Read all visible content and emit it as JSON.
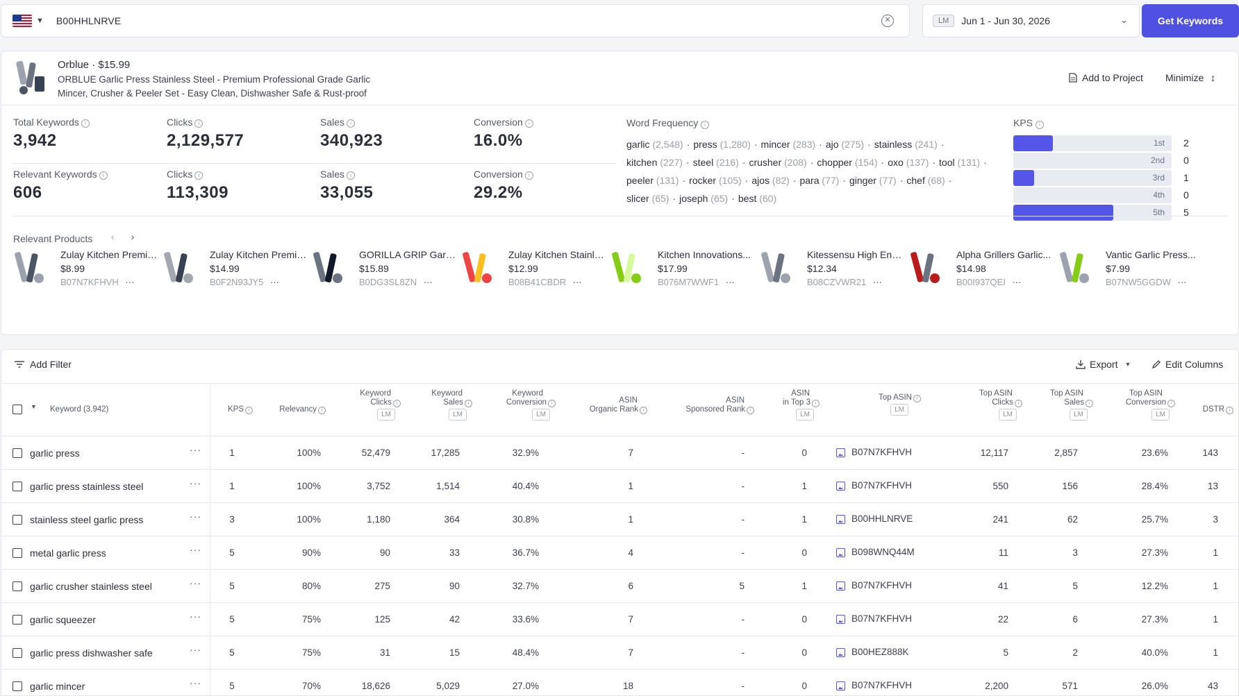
{
  "search": {
    "value": "B00HHLNRVE"
  },
  "date": {
    "tag": "LM",
    "range": "Jun 1 - Jun 30, 2026"
  },
  "buttons": {
    "get_keywords": "Get Keywords",
    "add_to_project": "Add to Project",
    "minimize": "Minimize",
    "add_filter": "Add Filter",
    "export": "Export",
    "edit_columns": "Edit Columns"
  },
  "product": {
    "brand": "Orblue",
    "price": "$15.99",
    "title": "ORBLUE Garlic Press Stainless Steel - Premium Professional Grade Garlic Mincer, Crusher & Peeler Set - Easy Clean, Dishwasher Safe & Rust-proof"
  },
  "stats": {
    "total_keywords": {
      "label": "Total Keywords",
      "value": "3,942"
    },
    "clicks": {
      "label": "Clicks",
      "value": "2,129,577"
    },
    "sales": {
      "label": "Sales",
      "value": "340,923"
    },
    "conversion": {
      "label": "Conversion",
      "value": "16.0%"
    },
    "relevant_keywords": {
      "label": "Relevant Keywords",
      "value": "606"
    },
    "rel_clicks": {
      "label": "Clicks",
      "value": "113,309"
    },
    "rel_sales": {
      "label": "Sales",
      "value": "33,055"
    },
    "rel_conversion": {
      "label": "Conversion",
      "value": "29.2%"
    }
  },
  "word_frequency": {
    "label": "Word Frequency",
    "words": [
      {
        "w": "garlic",
        "n": "(2,548)"
      },
      {
        "w": "press",
        "n": "(1,280)"
      },
      {
        "w": "mincer",
        "n": "(283)"
      },
      {
        "w": "ajo",
        "n": "(275)"
      },
      {
        "w": "stainless",
        "n": "(241)"
      },
      {
        "w": "kitchen",
        "n": "(227)"
      },
      {
        "w": "steel",
        "n": "(216)"
      },
      {
        "w": "crusher",
        "n": "(208)"
      },
      {
        "w": "chopper",
        "n": "(154)"
      },
      {
        "w": "oxo",
        "n": "(137)"
      },
      {
        "w": "tool",
        "n": "(131)"
      },
      {
        "w": "peeler",
        "n": "(131)"
      },
      {
        "w": "rocker",
        "n": "(105)"
      },
      {
        "w": "ajos",
        "n": "(82)"
      },
      {
        "w": "para",
        "n": "(77)"
      },
      {
        "w": "ginger",
        "n": "(77)"
      },
      {
        "w": "chef",
        "n": "(68)"
      },
      {
        "w": "slicer",
        "n": "(65)"
      },
      {
        "w": "joseph",
        "n": "(65)"
      },
      {
        "w": "best",
        "n": "(60)"
      }
    ]
  },
  "kps": {
    "label": "KPS",
    "rows": [
      {
        "name": "1st",
        "count": "2",
        "fill": 0.25
      },
      {
        "name": "2nd",
        "count": "0",
        "fill": 0
      },
      {
        "name": "3rd",
        "count": "1",
        "fill": 0.13
      },
      {
        "name": "4th",
        "count": "0",
        "fill": 0
      },
      {
        "name": "5th",
        "count": "5",
        "fill": 0.63
      }
    ]
  },
  "relevant_products": {
    "label": "Relevant Products",
    "items": [
      {
        "name": "Zulay Kitchen Premium...",
        "price": "$8.99",
        "asin": "B07N7KFHVH"
      },
      {
        "name": "Zulay Kitchen Premium...",
        "price": "$14.99",
        "asin": "B0F2N93JY5"
      },
      {
        "name": "GORILLA GRIP Garlic...",
        "price": "$15.89",
        "asin": "B0DG3SL8ZN"
      },
      {
        "name": "Zulay Kitchen Stainless...",
        "price": "$12.99",
        "asin": "B08B41CBDR"
      },
      {
        "name": "Kitchen Innovations...",
        "price": "$17.99",
        "asin": "B076M7WWF1"
      },
      {
        "name": "Kitessensu High End...",
        "price": "$12.34",
        "asin": "B08CZVWR21"
      },
      {
        "name": "Alpha Grillers Garlic...",
        "price": "$14.98",
        "asin": "B00I937QEI"
      },
      {
        "name": "Vantic Garlic Press...",
        "price": "$7.99",
        "asin": "B07NW5GGDW"
      }
    ]
  },
  "table": {
    "headers": {
      "keyword": "Keyword (3,942)",
      "kps": "KPS",
      "relevancy": "Relevancy",
      "kw_clicks_1": "Keyword",
      "kw_clicks_2": "Clicks",
      "kw_sales_1": "Keyword",
      "kw_sales_2": "Sales",
      "kw_conv_1": "Keyword",
      "kw_conv_2": "Conversion",
      "org_1": "ASIN",
      "org_2": "Organic Rank",
      "spon_1": "ASIN",
      "spon_2": "Sponsored Rank",
      "top3_1": "ASIN",
      "top3_2": "in Top 3",
      "top_asin": "Top ASIN",
      "ta_clicks_1": "Top ASIN",
      "ta_clicks_2": "Clicks",
      "ta_sales_1": "Top ASIN",
      "ta_sales_2": "Sales",
      "ta_conv_1": "Top ASIN",
      "ta_conv_2": "Conversion",
      "dstr": "DSTR",
      "lm": "LM"
    },
    "rows": [
      {
        "keyword": "garlic press",
        "kps": "1",
        "relevancy": "100%",
        "clicks": "52,479",
        "sales": "17,285",
        "conv": "32.9%",
        "organic": "7",
        "sponsored": "-",
        "top3": "0",
        "asin": "B07N7KFHVH",
        "ta_clicks": "12,117",
        "ta_sales": "2,857",
        "ta_conv": "23.6%",
        "dstr": "143"
      },
      {
        "keyword": "garlic press stainless steel",
        "kps": "1",
        "relevancy": "100%",
        "clicks": "3,752",
        "sales": "1,514",
        "conv": "40.4%",
        "organic": "1",
        "sponsored": "-",
        "top3": "1",
        "asin": "B07N7KFHVH",
        "ta_clicks": "550",
        "ta_sales": "156",
        "ta_conv": "28.4%",
        "dstr": "13"
      },
      {
        "keyword": "stainless steel garlic press",
        "kps": "3",
        "relevancy": "100%",
        "clicks": "1,180",
        "sales": "364",
        "conv": "30.8%",
        "organic": "1",
        "sponsored": "-",
        "top3": "1",
        "asin": "B00HHLNRVE",
        "ta_clicks": "241",
        "ta_sales": "62",
        "ta_conv": "25.7%",
        "dstr": "3"
      },
      {
        "keyword": "metal garlic press",
        "kps": "5",
        "relevancy": "90%",
        "clicks": "90",
        "sales": "33",
        "conv": "36.7%",
        "organic": "4",
        "sponsored": "-",
        "top3": "0",
        "asin": "B098WNQ44M",
        "ta_clicks": "11",
        "ta_sales": "3",
        "ta_conv": "27.3%",
        "dstr": "1"
      },
      {
        "keyword": "garlic crusher stainless steel",
        "kps": "5",
        "relevancy": "80%",
        "clicks": "275",
        "sales": "90",
        "conv": "32.7%",
        "organic": "6",
        "sponsored": "5",
        "top3": "1",
        "asin": "B07N7KFHVH",
        "ta_clicks": "41",
        "ta_sales": "5",
        "ta_conv": "12.2%",
        "dstr": "1"
      },
      {
        "keyword": "garlic squeezer",
        "kps": "5",
        "relevancy": "75%",
        "clicks": "125",
        "sales": "42",
        "conv": "33.6%",
        "organic": "7",
        "sponsored": "-",
        "top3": "0",
        "asin": "B07N7KFHVH",
        "ta_clicks": "22",
        "ta_sales": "6",
        "ta_conv": "27.3%",
        "dstr": "1"
      },
      {
        "keyword": "garlic press dishwasher safe",
        "kps": "5",
        "relevancy": "75%",
        "clicks": "31",
        "sales": "15",
        "conv": "48.4%",
        "organic": "7",
        "sponsored": "-",
        "top3": "0",
        "asin": "B00HEZ888K",
        "ta_clicks": "5",
        "ta_sales": "2",
        "ta_conv": "40.0%",
        "dstr": "1"
      },
      {
        "keyword": "garlic mincer",
        "kps": "5",
        "relevancy": "70%",
        "clicks": "18,626",
        "sales": "5,029",
        "conv": "27.0%",
        "organic": "18",
        "sponsored": "-",
        "top3": "0",
        "asin": "B07N7KFHVH",
        "ta_clicks": "2,200",
        "ta_sales": "571",
        "ta_conv": "26.0%",
        "dstr": "43"
      }
    ]
  }
}
